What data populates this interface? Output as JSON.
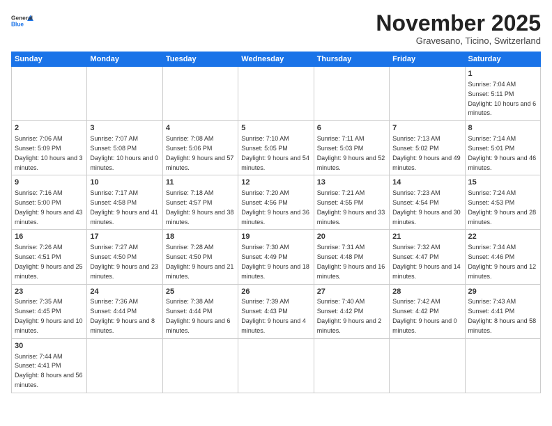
{
  "header": {
    "logo_general": "General",
    "logo_blue": "Blue",
    "month_title": "November 2025",
    "subtitle": "Gravesano, Ticino, Switzerland"
  },
  "weekdays": [
    "Sunday",
    "Monday",
    "Tuesday",
    "Wednesday",
    "Thursday",
    "Friday",
    "Saturday"
  ],
  "weeks": [
    [
      {
        "day": "",
        "info": ""
      },
      {
        "day": "",
        "info": ""
      },
      {
        "day": "",
        "info": ""
      },
      {
        "day": "",
        "info": ""
      },
      {
        "day": "",
        "info": ""
      },
      {
        "day": "",
        "info": ""
      },
      {
        "day": "1",
        "info": "Sunrise: 7:04 AM\nSunset: 5:11 PM\nDaylight: 10 hours and 6 minutes."
      }
    ],
    [
      {
        "day": "2",
        "info": "Sunrise: 7:06 AM\nSunset: 5:09 PM\nDaylight: 10 hours and 3 minutes."
      },
      {
        "day": "3",
        "info": "Sunrise: 7:07 AM\nSunset: 5:08 PM\nDaylight: 10 hours and 0 minutes."
      },
      {
        "day": "4",
        "info": "Sunrise: 7:08 AM\nSunset: 5:06 PM\nDaylight: 9 hours and 57 minutes."
      },
      {
        "day": "5",
        "info": "Sunrise: 7:10 AM\nSunset: 5:05 PM\nDaylight: 9 hours and 54 minutes."
      },
      {
        "day": "6",
        "info": "Sunrise: 7:11 AM\nSunset: 5:03 PM\nDaylight: 9 hours and 52 minutes."
      },
      {
        "day": "7",
        "info": "Sunrise: 7:13 AM\nSunset: 5:02 PM\nDaylight: 9 hours and 49 minutes."
      },
      {
        "day": "8",
        "info": "Sunrise: 7:14 AM\nSunset: 5:01 PM\nDaylight: 9 hours and 46 minutes."
      }
    ],
    [
      {
        "day": "9",
        "info": "Sunrise: 7:16 AM\nSunset: 5:00 PM\nDaylight: 9 hours and 43 minutes."
      },
      {
        "day": "10",
        "info": "Sunrise: 7:17 AM\nSunset: 4:58 PM\nDaylight: 9 hours and 41 minutes."
      },
      {
        "day": "11",
        "info": "Sunrise: 7:18 AM\nSunset: 4:57 PM\nDaylight: 9 hours and 38 minutes."
      },
      {
        "day": "12",
        "info": "Sunrise: 7:20 AM\nSunset: 4:56 PM\nDaylight: 9 hours and 36 minutes."
      },
      {
        "day": "13",
        "info": "Sunrise: 7:21 AM\nSunset: 4:55 PM\nDaylight: 9 hours and 33 minutes."
      },
      {
        "day": "14",
        "info": "Sunrise: 7:23 AM\nSunset: 4:54 PM\nDaylight: 9 hours and 30 minutes."
      },
      {
        "day": "15",
        "info": "Sunrise: 7:24 AM\nSunset: 4:53 PM\nDaylight: 9 hours and 28 minutes."
      }
    ],
    [
      {
        "day": "16",
        "info": "Sunrise: 7:26 AM\nSunset: 4:51 PM\nDaylight: 9 hours and 25 minutes."
      },
      {
        "day": "17",
        "info": "Sunrise: 7:27 AM\nSunset: 4:50 PM\nDaylight: 9 hours and 23 minutes."
      },
      {
        "day": "18",
        "info": "Sunrise: 7:28 AM\nSunset: 4:50 PM\nDaylight: 9 hours and 21 minutes."
      },
      {
        "day": "19",
        "info": "Sunrise: 7:30 AM\nSunset: 4:49 PM\nDaylight: 9 hours and 18 minutes."
      },
      {
        "day": "20",
        "info": "Sunrise: 7:31 AM\nSunset: 4:48 PM\nDaylight: 9 hours and 16 minutes."
      },
      {
        "day": "21",
        "info": "Sunrise: 7:32 AM\nSunset: 4:47 PM\nDaylight: 9 hours and 14 minutes."
      },
      {
        "day": "22",
        "info": "Sunrise: 7:34 AM\nSunset: 4:46 PM\nDaylight: 9 hours and 12 minutes."
      }
    ],
    [
      {
        "day": "23",
        "info": "Sunrise: 7:35 AM\nSunset: 4:45 PM\nDaylight: 9 hours and 10 minutes."
      },
      {
        "day": "24",
        "info": "Sunrise: 7:36 AM\nSunset: 4:44 PM\nDaylight: 9 hours and 8 minutes."
      },
      {
        "day": "25",
        "info": "Sunrise: 7:38 AM\nSunset: 4:44 PM\nDaylight: 9 hours and 6 minutes."
      },
      {
        "day": "26",
        "info": "Sunrise: 7:39 AM\nSunset: 4:43 PM\nDaylight: 9 hours and 4 minutes."
      },
      {
        "day": "27",
        "info": "Sunrise: 7:40 AM\nSunset: 4:42 PM\nDaylight: 9 hours and 2 minutes."
      },
      {
        "day": "28",
        "info": "Sunrise: 7:42 AM\nSunset: 4:42 PM\nDaylight: 9 hours and 0 minutes."
      },
      {
        "day": "29",
        "info": "Sunrise: 7:43 AM\nSunset: 4:41 PM\nDaylight: 8 hours and 58 minutes."
      }
    ],
    [
      {
        "day": "30",
        "info": "Sunrise: 7:44 AM\nSunset: 4:41 PM\nDaylight: 8 hours and 56 minutes."
      },
      {
        "day": "",
        "info": ""
      },
      {
        "day": "",
        "info": ""
      },
      {
        "day": "",
        "info": ""
      },
      {
        "day": "",
        "info": ""
      },
      {
        "day": "",
        "info": ""
      },
      {
        "day": "",
        "info": ""
      }
    ]
  ]
}
